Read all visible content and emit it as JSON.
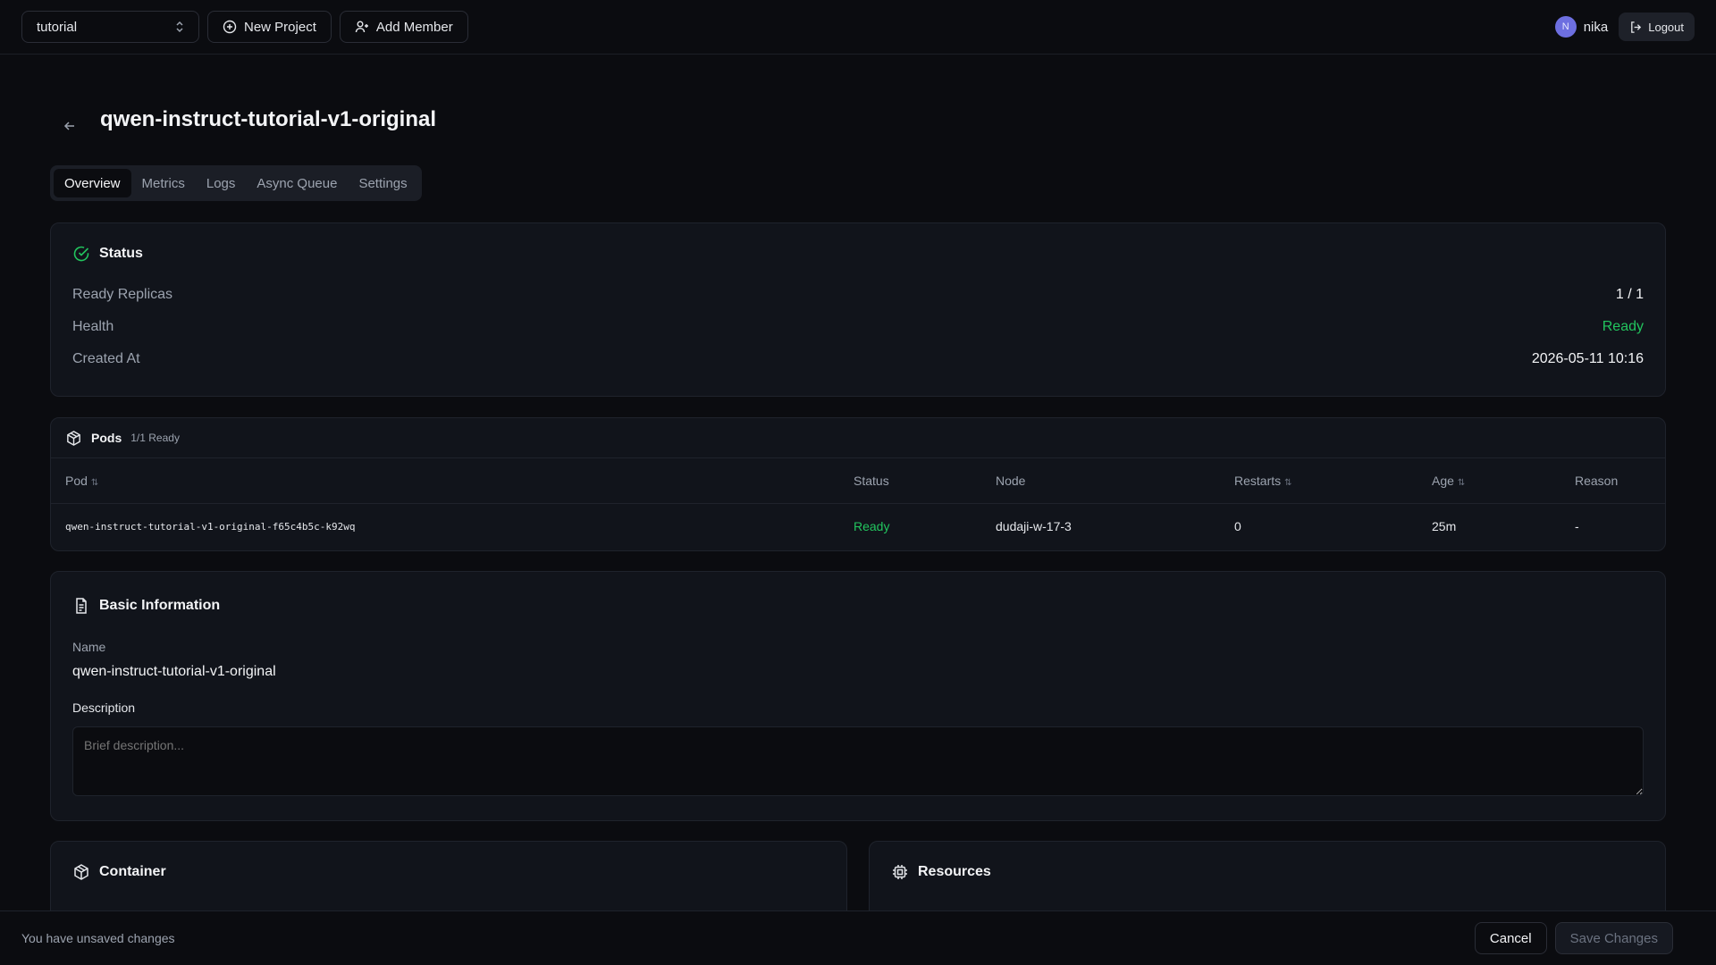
{
  "topbar": {
    "project": "tutorial",
    "new_project": "New Project",
    "add_member": "Add Member",
    "user_initial": "N",
    "username": "nika",
    "logout": "Logout"
  },
  "page": {
    "title": "qwen-instruct-tutorial-v1-original",
    "tabs": [
      "Overview",
      "Metrics",
      "Logs",
      "Async Queue",
      "Settings"
    ],
    "active_tab": "Overview"
  },
  "status": {
    "heading": "Status",
    "rows": [
      {
        "label": "Ready Replicas",
        "value": "1 / 1"
      },
      {
        "label": "Health",
        "value": "Ready"
      },
      {
        "label": "Created At",
        "value": "2026-05-11 10:16"
      }
    ]
  },
  "pods": {
    "heading": "Pods",
    "summary": "1/1 Ready",
    "columns": [
      "Pod",
      "Status",
      "Node",
      "Restarts",
      "Age",
      "Reason"
    ],
    "rows": [
      {
        "pod": "qwen-instruct-tutorial-v1-original-f65c4b5c-k92wq",
        "status": "Ready",
        "node": "dudaji-w-17-3",
        "restarts": "0",
        "age": "25m",
        "reason": "-"
      }
    ]
  },
  "basic": {
    "heading": "Basic Information",
    "name_label": "Name",
    "name_value": "qwen-instruct-tutorial-v1-original",
    "desc_label": "Description",
    "desc_placeholder": "Brief description..."
  },
  "container": {
    "heading": "Container"
  },
  "resources": {
    "heading": "Resources"
  },
  "footer": {
    "message": "You have unsaved changes",
    "cancel": "Cancel",
    "save": "Save Changes"
  },
  "colors": {
    "success": "#22c55e",
    "avatar": "#6d6fe0"
  }
}
